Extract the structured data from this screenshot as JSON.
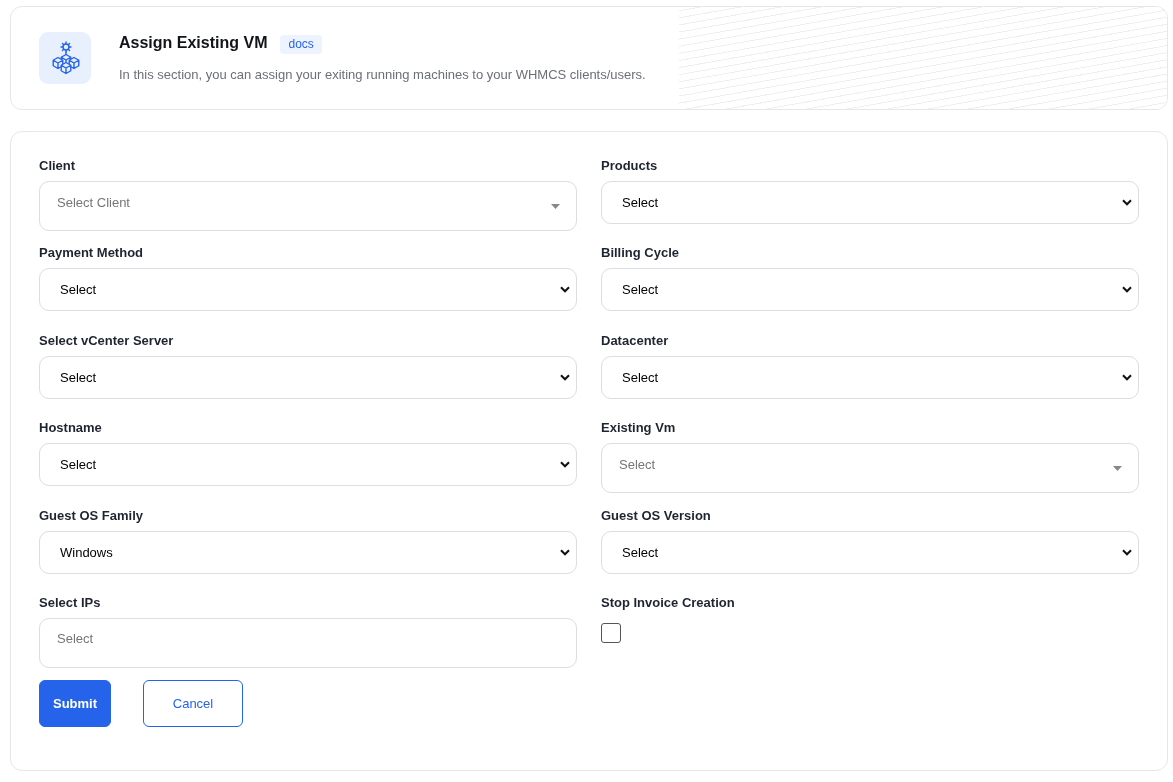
{
  "header": {
    "title": "Assign Existing VM",
    "badge": "docs",
    "description": "In this section, you can assign your exiting running machines to your WHMCS clients/users."
  },
  "form": {
    "fields": [
      {
        "kind": "select2",
        "label": "Client",
        "placeholder": "Select Client"
      },
      {
        "kind": "select",
        "label": "Products",
        "value": "Select"
      },
      {
        "kind": "select",
        "label": "Payment Method",
        "value": "Select"
      },
      {
        "kind": "select",
        "label": "Billing Cycle",
        "value": "Select"
      },
      {
        "kind": "select",
        "label": "Select vCenter Server",
        "value": "Select"
      },
      {
        "kind": "select",
        "label": "Datacenter",
        "value": "Select"
      },
      {
        "kind": "select",
        "label": "Hostname",
        "value": "Select"
      },
      {
        "kind": "select2",
        "label": "Existing Vm",
        "placeholder": "Select"
      },
      {
        "kind": "select",
        "label": "Guest OS Family",
        "value": "Windows"
      },
      {
        "kind": "select",
        "label": "Guest OS Version",
        "value": "Select"
      },
      {
        "kind": "multiselect",
        "label": "Select IPs",
        "placeholder": "Select"
      },
      {
        "kind": "checkbox",
        "label": "Stop Invoice Creation",
        "checked": false
      }
    ],
    "buttons": [
      {
        "kind": "primary",
        "label": "Submit"
      },
      {
        "kind": "secondary",
        "label": "Cancel"
      }
    ]
  }
}
